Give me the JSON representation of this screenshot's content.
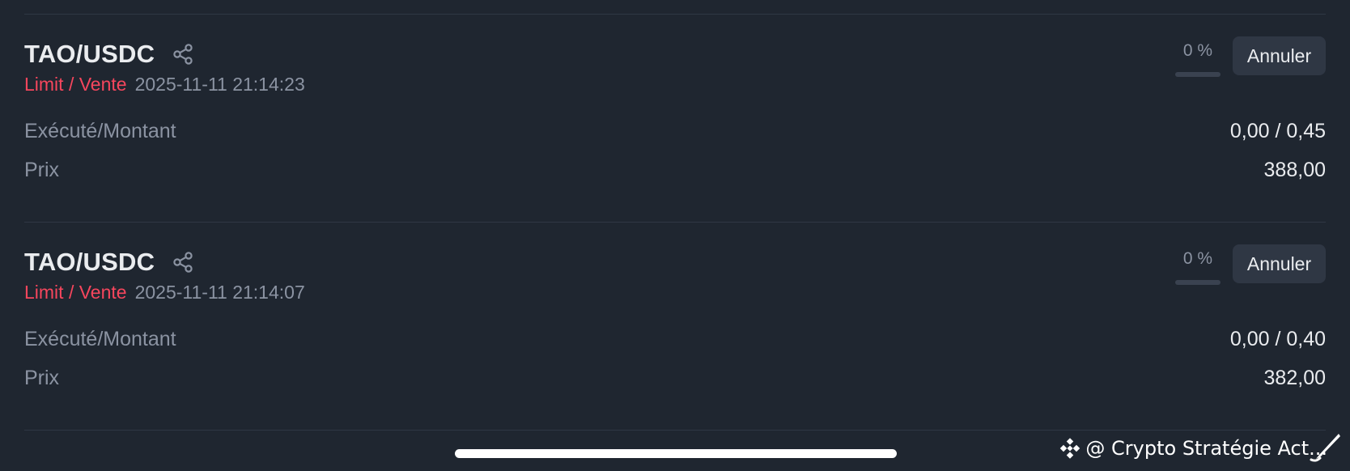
{
  "orders": [
    {
      "pair": "TAO/USDC",
      "side_label": "Limit / Vente",
      "timestamp": "2025-11-11 21:14:23",
      "progress_text": "0 %",
      "progress_fraction": 0,
      "cancel_label": "Annuler",
      "filled_label": "Exécuté/Montant",
      "filled_value": "0,00 / 0,45",
      "price_label": "Prix",
      "price_value": "388,00"
    },
    {
      "pair": "TAO/USDC",
      "side_label": "Limit / Vente",
      "timestamp": "2025-11-11 21:14:07",
      "progress_text": "0 %",
      "progress_fraction": 0,
      "cancel_label": "Annuler",
      "filled_label": "Exécuté/Montant",
      "filled_value": "0,00 / 0,40",
      "price_label": "Prix",
      "price_value": "382,00"
    }
  ],
  "watermark": {
    "text": "@ Crypto Stratégie Act..."
  },
  "colors": {
    "background": "#1f2630",
    "sell": "#f6465d",
    "muted": "#8b93a2",
    "text": "#eaecef",
    "button_bg": "#2f3744"
  },
  "icons": {
    "share": "share-icon",
    "watermark_logo": "binance-logo-icon",
    "pen": "pen-icon"
  }
}
